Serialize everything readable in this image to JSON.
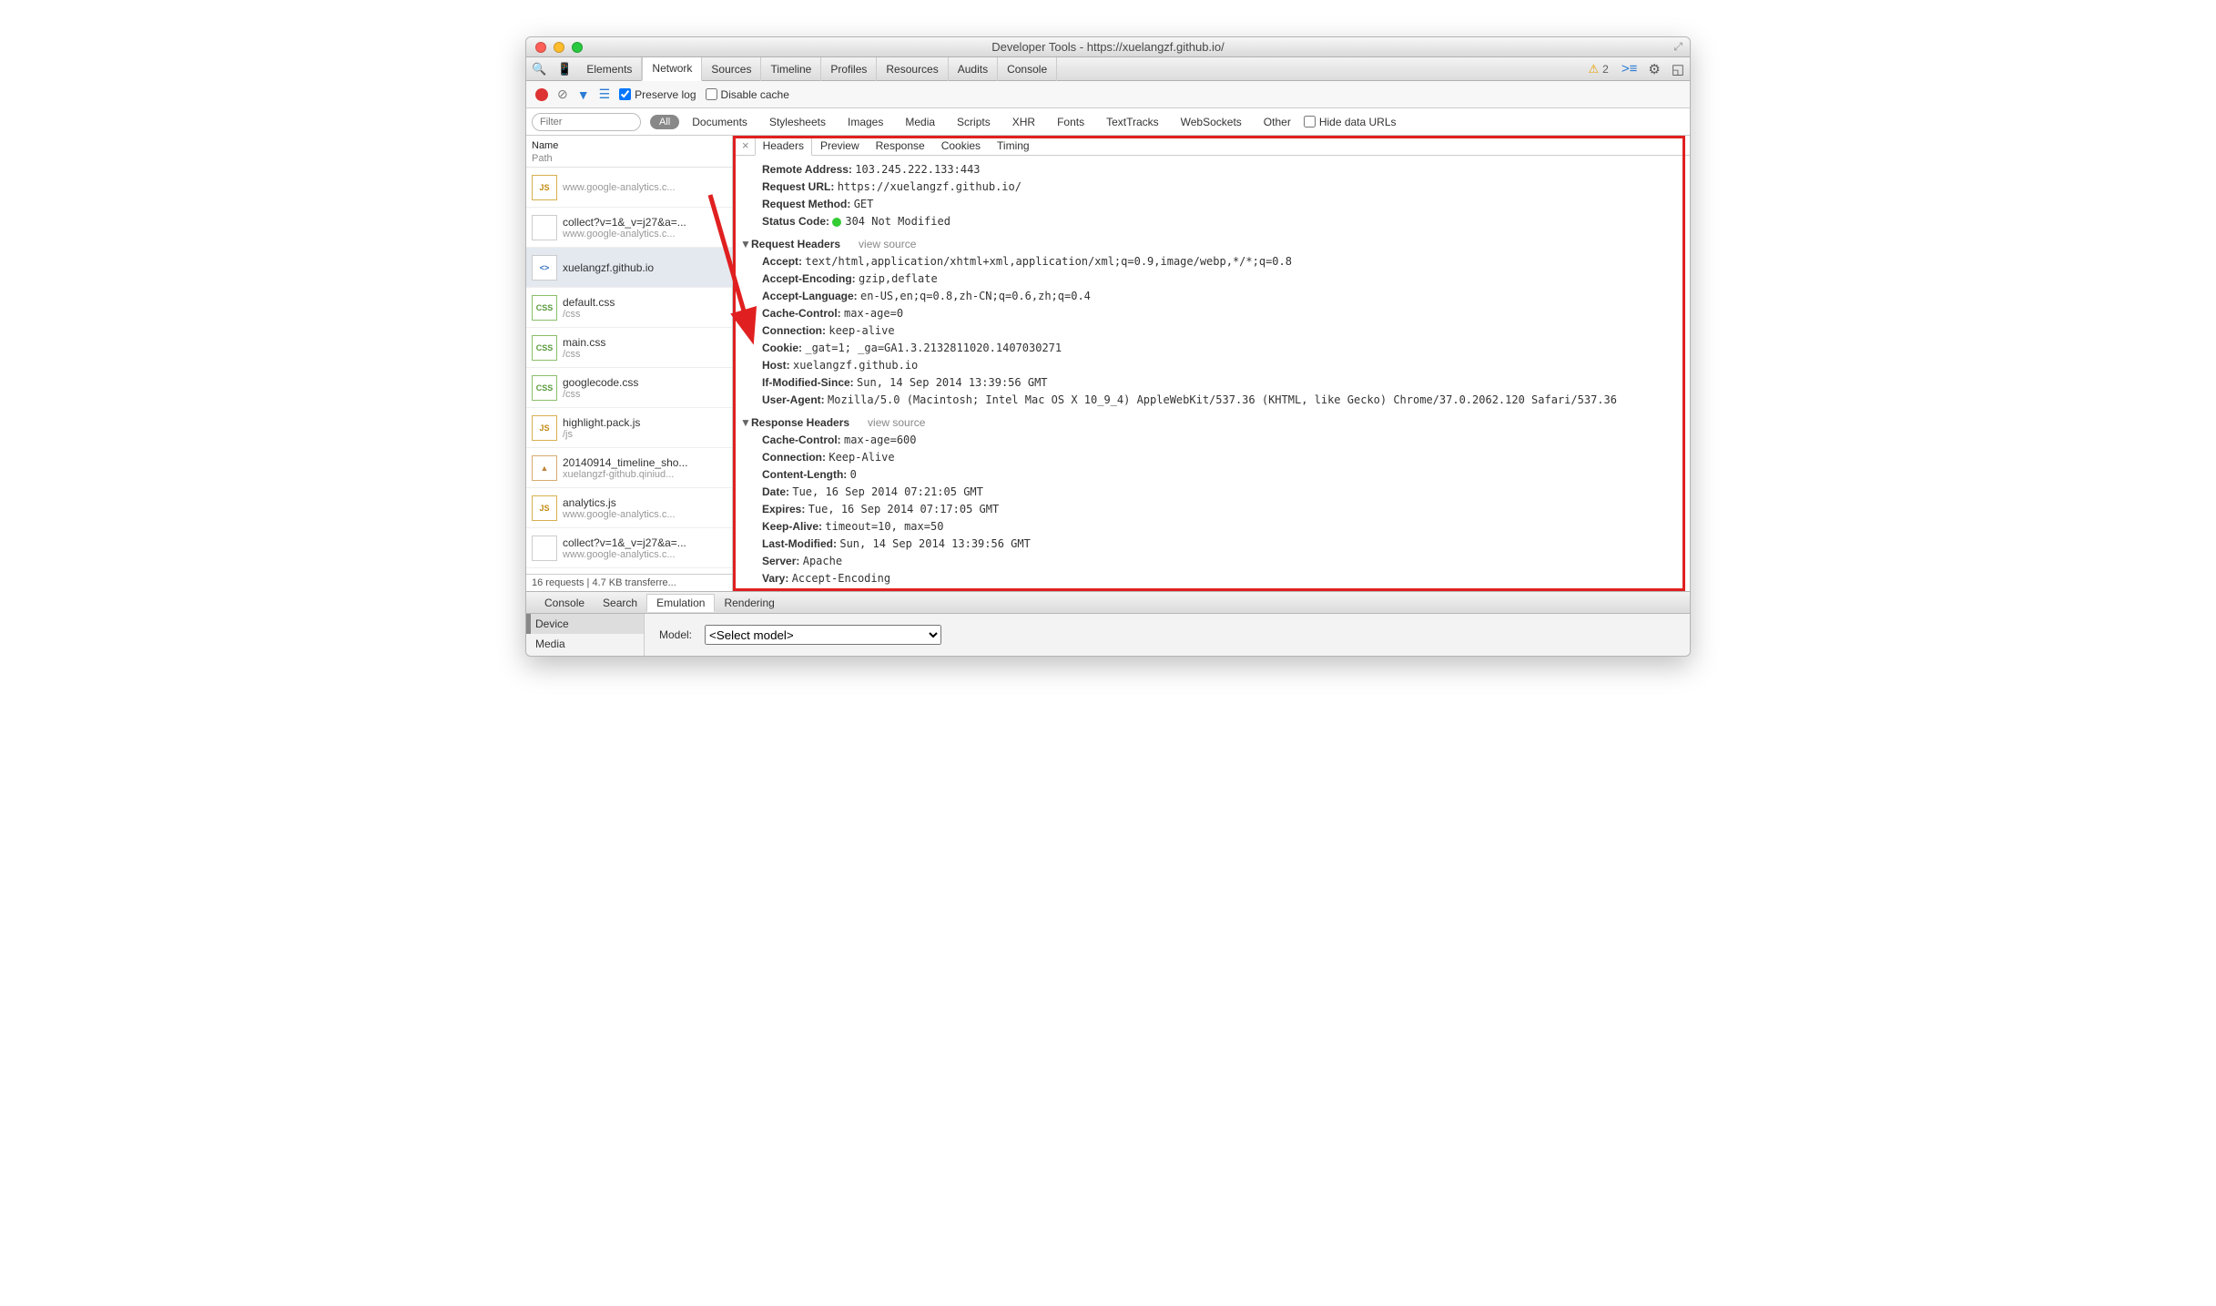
{
  "window_title": "Developer Tools - https://xuelangzf.github.io/",
  "main_tabs": [
    "Elements",
    "Network",
    "Sources",
    "Timeline",
    "Profiles",
    "Resources",
    "Audits",
    "Console"
  ],
  "main_tab_active": "Network",
  "warn_count": "2",
  "toolbar": {
    "preserve_log": "Preserve log",
    "disable_cache": "Disable cache"
  },
  "filter": {
    "placeholder": "Filter",
    "all": "All",
    "types": [
      "Documents",
      "Stylesheets",
      "Images",
      "Media",
      "Scripts",
      "XHR",
      "Fonts",
      "TextTracks",
      "WebSockets",
      "Other"
    ],
    "hide": "Hide data URLs"
  },
  "left": {
    "h1": "Name",
    "h2": "Path",
    "status": "16 requests | 4.7 KB transferre..."
  },
  "requests": [
    {
      "name": "",
      "path": "www.google-analytics.c...",
      "ic": "js"
    },
    {
      "name": "collect?v=1&_v=j27&a=...",
      "path": "www.google-analytics.c...",
      "ic": "doc"
    },
    {
      "name": "xuelangzf.github.io",
      "path": "",
      "ic": "html",
      "sel": true
    },
    {
      "name": "default.css",
      "path": "/css",
      "ic": "css"
    },
    {
      "name": "main.css",
      "path": "/css",
      "ic": "css"
    },
    {
      "name": "googlecode.css",
      "path": "/css",
      "ic": "css"
    },
    {
      "name": "highlight.pack.js",
      "path": "/js",
      "ic": "js"
    },
    {
      "name": "20140914_timeline_sho...",
      "path": "xuelangzf-github.qiniud...",
      "ic": "img"
    },
    {
      "name": "analytics.js",
      "path": "www.google-analytics.c...",
      "ic": "js"
    },
    {
      "name": "collect?v=1&_v=j27&a=...",
      "path": "www.google-analytics.c...",
      "ic": "doc"
    }
  ],
  "detail_tabs": [
    "Headers",
    "Preview",
    "Response",
    "Cookies",
    "Timing"
  ],
  "detail_tab_active": "Headers",
  "general": [
    {
      "k": "Remote Address:",
      "v": "103.245.222.133:443"
    },
    {
      "k": "Request URL:",
      "v": "https://xuelangzf.github.io/"
    },
    {
      "k": "Request Method:",
      "v": "GET"
    },
    {
      "k": "Status Code:",
      "v": "304 Not Modified",
      "dot": true
    }
  ],
  "req_title": "Request Headers",
  "view_source": "view source",
  "req": [
    {
      "k": "Accept:",
      "v": "text/html,application/xhtml+xml,application/xml;q=0.9,image/webp,*/*;q=0.8"
    },
    {
      "k": "Accept-Encoding:",
      "v": "gzip,deflate"
    },
    {
      "k": "Accept-Language:",
      "v": "en-US,en;q=0.8,zh-CN;q=0.6,zh;q=0.4"
    },
    {
      "k": "Cache-Control:",
      "v": "max-age=0"
    },
    {
      "k": "Connection:",
      "v": "keep-alive"
    },
    {
      "k": "Cookie:",
      "v": "_gat=1; _ga=GA1.3.2132811020.1407030271"
    },
    {
      "k": "Host:",
      "v": "xuelangzf.github.io"
    },
    {
      "k": "If-Modified-Since:",
      "v": "Sun, 14 Sep 2014 13:39:56 GMT"
    },
    {
      "k": "User-Agent:",
      "v": "Mozilla/5.0 (Macintosh; Intel Mac OS X 10_9_4) AppleWebKit/537.36 (KHTML, like Gecko) Chrome/37.0.2062.120 Safari/537.36"
    }
  ],
  "res_title": "Response Headers",
  "res": [
    {
      "k": "Cache-Control:",
      "v": "max-age=600"
    },
    {
      "k": "Connection:",
      "v": "Keep-Alive"
    },
    {
      "k": "Content-Length:",
      "v": "0"
    },
    {
      "k": "Date:",
      "v": "Tue, 16 Sep 2014 07:21:05 GMT"
    },
    {
      "k": "Expires:",
      "v": "Tue, 16 Sep 2014 07:17:05 GMT"
    },
    {
      "k": "Keep-Alive:",
      "v": "timeout=10, max=50"
    },
    {
      "k": "Last-Modified:",
      "v": "Sun, 14 Sep 2014 13:39:56 GMT"
    },
    {
      "k": "Server:",
      "v": "Apache"
    },
    {
      "k": "Vary:",
      "v": "Accept-Encoding"
    }
  ],
  "drawer": {
    "tabs": [
      "Console",
      "Search",
      "Emulation",
      "Rendering"
    ],
    "active": "Emulation",
    "side": [
      "Device",
      "Media"
    ],
    "side_active": "Device",
    "model_label": "Model:",
    "model_value": "<Select model>"
  }
}
